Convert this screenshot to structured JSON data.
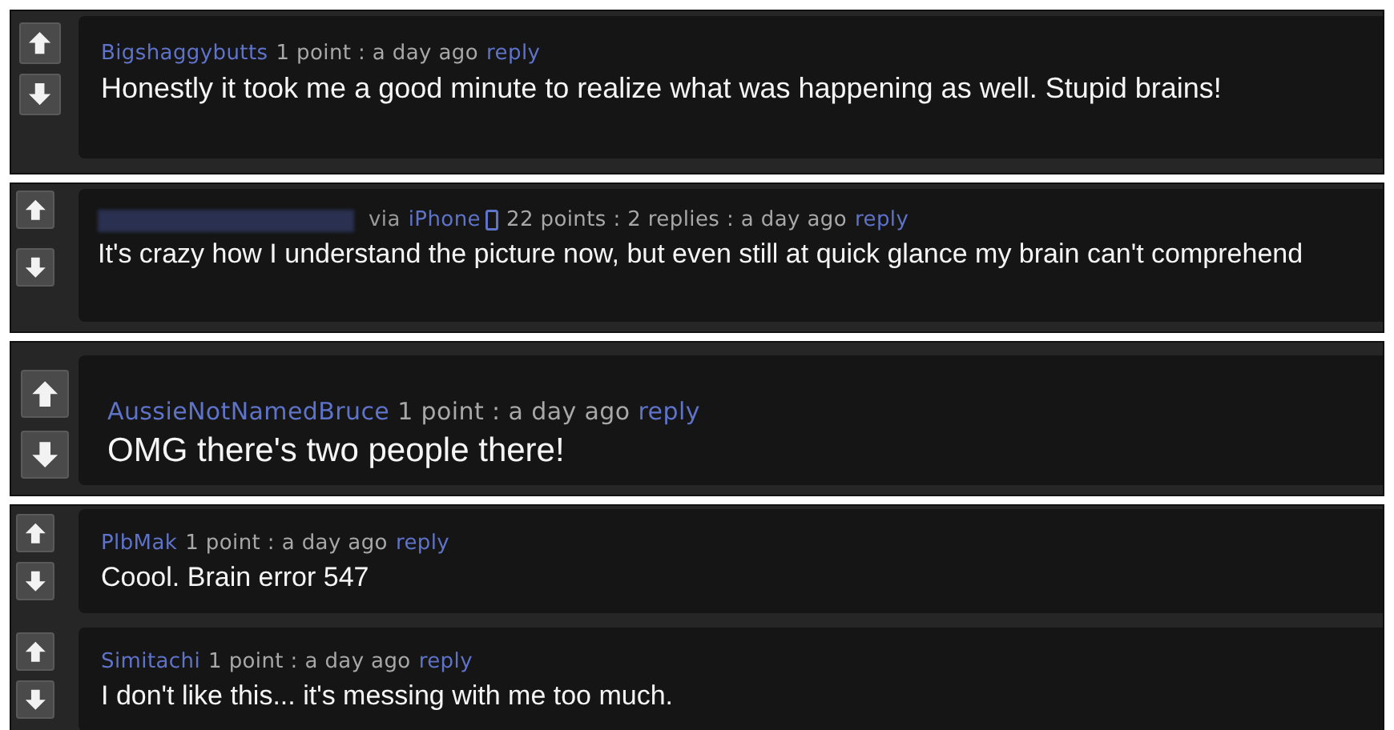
{
  "panels": [
    {
      "comments": [
        {
          "author": "Bigshaggybutts",
          "author_hidden": false,
          "meta": "1 point : a day ago",
          "reply": "reply",
          "body": "Honestly it took me a good minute to realize what was happening as well. Stupid brains!"
        }
      ]
    },
    {
      "comments": [
        {
          "author_hidden": true,
          "via": "via",
          "device": "iPhone",
          "meta": "22 points : 2 replies : a day ago",
          "reply": "reply",
          "body": "It's crazy how I understand the picture now, but even still at quick glance my brain can't comprehend"
        }
      ]
    },
    {
      "comments": [
        {
          "author": "AussieNotNamedBruce",
          "author_hidden": false,
          "meta": "1 point : a day ago",
          "reply": "reply",
          "body": "OMG there's two people there!"
        }
      ]
    },
    {
      "comments": [
        {
          "author": "PlbMak",
          "author_hidden": false,
          "meta": "1 point : a day ago",
          "reply": "reply",
          "body": "Coool. Brain error 547"
        },
        {
          "author": "Simitachi",
          "author_hidden": false,
          "meta": "1 point : a day ago",
          "reply": "reply",
          "body": "I don't like this... it's messing with me too much."
        }
      ]
    }
  ]
}
